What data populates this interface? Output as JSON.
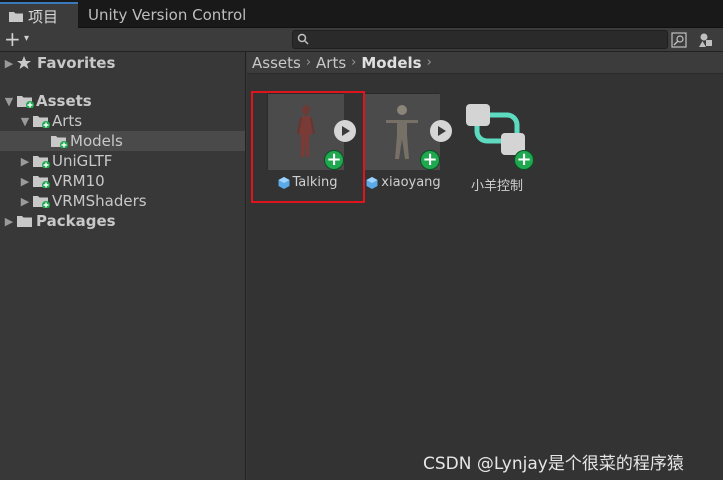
{
  "tabs": [
    {
      "label": "项目",
      "icon": "folder-icon"
    },
    {
      "label": "Unity Version Control"
    }
  ],
  "toolbar": {
    "add_label": "+",
    "add_caret": "▾",
    "search_value": ""
  },
  "sidebar": {
    "items": [
      {
        "label": "Favorites",
        "icon": "star-icon"
      },
      {
        "label": "Assets",
        "icon": "folder-icon"
      },
      {
        "label": "Arts",
        "icon": "folder-icon"
      },
      {
        "label": "Models",
        "icon": "folder-icon"
      },
      {
        "label": "UniGLTF",
        "icon": "folder-icon"
      },
      {
        "label": "VRM10",
        "icon": "folder-icon"
      },
      {
        "label": "VRMShaders",
        "icon": "folder-icon"
      },
      {
        "label": "Packages",
        "icon": "folder-icon"
      }
    ]
  },
  "breadcrumb": {
    "items": [
      "Assets",
      "Arts",
      "Models"
    ]
  },
  "assets": [
    {
      "label": "Talking",
      "icon": "model-prefab-icon"
    },
    {
      "label": "xiaoyang",
      "icon": "model-prefab-icon"
    },
    {
      "label": "小羊控制",
      "icon": "animator-controller-icon"
    }
  ],
  "colors": {
    "accent": "#3a79bb",
    "add_badge": "#1fa84f",
    "highlight": "#e0141c",
    "controller": "#5ddbc0"
  },
  "watermark": "CSDN @Lynjay是个很菜的程序猿"
}
